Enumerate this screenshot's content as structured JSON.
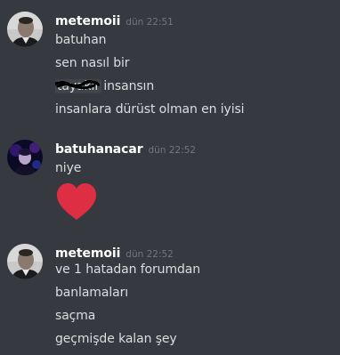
{
  "messages": [
    {
      "username": "metemoii",
      "timestamp": "dün 22:51",
      "lines": [
        "batuhan",
        "sen nasıl bir",
        {
          "spoiler": "tayakir",
          "text": " insansın"
        },
        "insanlara dürüst olman en iyisi"
      ]
    },
    {
      "username": "batuhanacar",
      "timestamp": "dün 22:52",
      "lines": [
        "niye"
      ],
      "emoji": "red-heart"
    },
    {
      "username": "metemoii",
      "timestamp": "dün 22:52",
      "lines": [
        "ve 1 hatadan forumdan",
        "banlamaları",
        "saçma",
        "geçmişde kalan şey"
      ]
    }
  ],
  "colors": {
    "background": "#36393f",
    "username": "#ffffff",
    "message_text": "#dcddde",
    "timestamp": "#72767d",
    "heart": "#dd2e44"
  }
}
